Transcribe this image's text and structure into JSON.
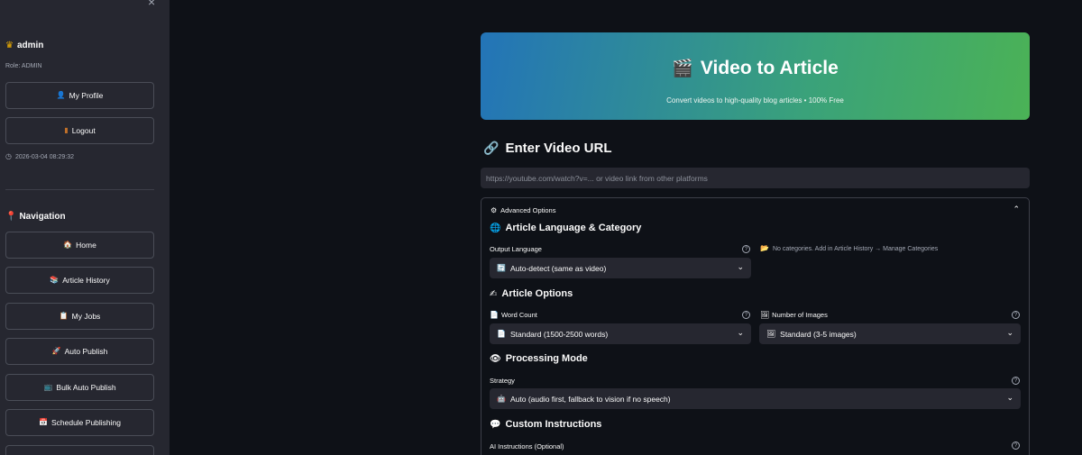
{
  "sidebar": {
    "close_glyph": "×",
    "username": "admin",
    "role": "Role: ADMIN",
    "profile_label": "My Profile",
    "logout_label": "Logout",
    "timestamp": "2026-03-04 08:29:32",
    "nav_heading": "Navigation",
    "nav_items": [
      {
        "label": "Home",
        "icon": "home-icon"
      },
      {
        "label": "Article History",
        "icon": "books-icon"
      },
      {
        "label": "My Jobs",
        "icon": "clipboard-icon"
      },
      {
        "label": "Auto Publish",
        "icon": "rocket-icon"
      },
      {
        "label": "Bulk Auto Publish",
        "icon": "tv-icon"
      },
      {
        "label": "Schedule Publishing",
        "icon": "calendar-icon"
      }
    ]
  },
  "banner": {
    "title": "Video to Article",
    "subtitle": "Convert videos to high-quality blog articles • 100% Free"
  },
  "url_section": {
    "heading": "Enter Video URL",
    "placeholder": "https://youtube.com/watch?v=... or video link from other platforms"
  },
  "advanced": {
    "label": "Advanced Options",
    "lang_heading": "Article Language & Category",
    "output_language_label": "Output Language",
    "output_language_value": "Auto-detect (same as video)",
    "category_note": "No categories. Add in Article History → Manage Categories",
    "options_heading": "Article Options",
    "word_count_label": "Word Count",
    "word_count_value": "Standard (1500-2500 words)",
    "images_label": "Number of Images",
    "images_value": "Standard (3-5 images)",
    "processing_heading": "Processing Mode",
    "strategy_label": "Strategy",
    "strategy_value": "Auto (audio first, fallback to vision if no speech)",
    "custom_heading": "Custom Instructions",
    "ai_instructions_label": "AI Instructions (Optional)"
  }
}
